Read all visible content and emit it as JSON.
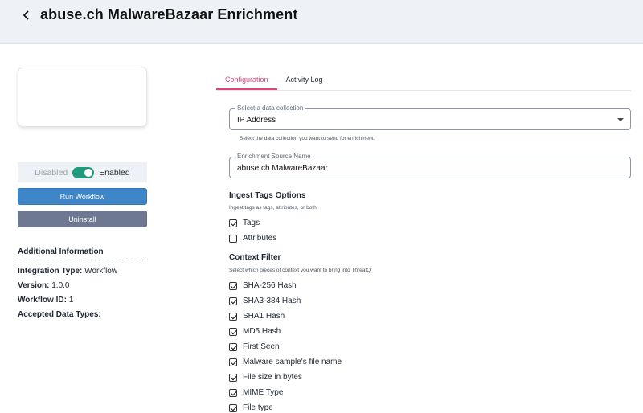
{
  "header": {
    "title": "abuse.ch MalwareBazaar Enrichment"
  },
  "sidebar": {
    "toggle": {
      "off_label": "Disabled",
      "on_label": "Enabled",
      "enabled": true
    },
    "run_button": "Run Workflow",
    "uninstall_button": "Uninstall",
    "info": {
      "title": "Additional Information",
      "integration_type_label": "Integration Type:",
      "integration_type": "Workflow",
      "version_label": "Version:",
      "version": "1.0.0",
      "workflow_id_label": "Workflow ID:",
      "workflow_id": "1",
      "accepted_label": "Accepted Data Types:"
    }
  },
  "tabs": [
    {
      "label": "Configuration",
      "active": true
    },
    {
      "label": "Activity Log",
      "active": false
    }
  ],
  "form": {
    "collection": {
      "legend": "Select a data collection",
      "value": "IP Address",
      "hint": "Select the data collection you want to send for enrichment."
    },
    "source": {
      "legend": "Enrichment Source Name",
      "value": "abuse.ch MalwareBazaar"
    },
    "ingest": {
      "title": "Ingest Tags Options",
      "hint": "Ingest tags as tags, attributes, or both",
      "options": [
        {
          "label": "Tags",
          "checked": true
        },
        {
          "label": "Attributes",
          "checked": false
        }
      ]
    },
    "context": {
      "title": "Context Filter",
      "hint": "Select which pieces of context you want to bring into ThreatQ",
      "options": [
        {
          "label": "SHA-256 Hash",
          "checked": true
        },
        {
          "label": "SHA3-384 Hash",
          "checked": true
        },
        {
          "label": "SHA1 Hash",
          "checked": true
        },
        {
          "label": "MD5 Hash",
          "checked": true
        },
        {
          "label": "First Seen",
          "checked": true
        },
        {
          "label": "Malware sample's file name",
          "checked": true
        },
        {
          "label": "File size in bytes",
          "checked": true
        },
        {
          "label": "MIME Type",
          "checked": true
        },
        {
          "label": "File type",
          "checked": true
        }
      ]
    }
  }
}
